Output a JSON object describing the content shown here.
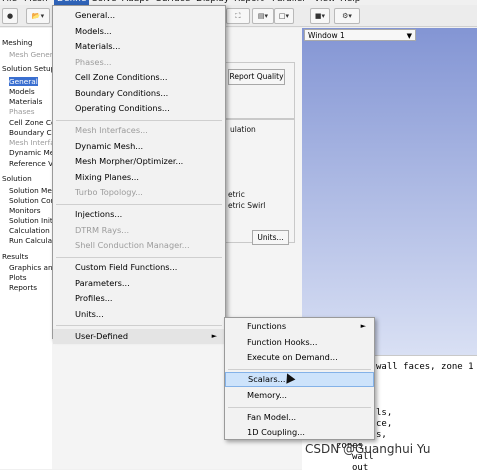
{
  "menubar": {
    "items": [
      {
        "label": "File",
        "active": false
      },
      {
        "label": "Mesh",
        "active": false
      },
      {
        "label": "Define",
        "active": true
      },
      {
        "label": "Solve",
        "active": false
      },
      {
        "label": "Adapt",
        "active": false
      },
      {
        "label": "Surface",
        "active": false
      },
      {
        "label": "Display",
        "active": false
      },
      {
        "label": "Report",
        "active": false
      },
      {
        "label": "Parallel",
        "active": false
      },
      {
        "label": "View",
        "active": false
      },
      {
        "label": "Help",
        "active": false
      }
    ]
  },
  "tree": {
    "items": [
      {
        "label": "Meshing",
        "kind": "h"
      },
      {
        "label": "Mesh Generation",
        "kind": "i g"
      },
      {
        "label": "Solution Setup",
        "kind": "h"
      },
      {
        "label": "General",
        "kind": "i sel"
      },
      {
        "label": "Models",
        "kind": "i"
      },
      {
        "label": "Materials",
        "kind": "i"
      },
      {
        "label": "Phases",
        "kind": "i g"
      },
      {
        "label": "Cell Zone Conditions",
        "kind": "i"
      },
      {
        "label": "Boundary Conditions",
        "kind": "i"
      },
      {
        "label": "Mesh Interfaces",
        "kind": "i g"
      },
      {
        "label": "Dynamic Mesh",
        "kind": "i"
      },
      {
        "label": "Reference Values",
        "kind": "i"
      },
      {
        "label": "Solution",
        "kind": "h"
      },
      {
        "label": "Solution Methods",
        "kind": "i"
      },
      {
        "label": "Solution Controls",
        "kind": "i"
      },
      {
        "label": "Monitors",
        "kind": "i"
      },
      {
        "label": "Solution Initialization",
        "kind": "i"
      },
      {
        "label": "Calculation Activities",
        "kind": "i"
      },
      {
        "label": "Run Calculation",
        "kind": "i"
      },
      {
        "label": "Results",
        "kind": "h"
      },
      {
        "label": "Graphics and Animations",
        "kind": "i"
      },
      {
        "label": "Plots",
        "kind": "i"
      },
      {
        "label": "Reports",
        "kind": "i"
      }
    ]
  },
  "panel": {
    "report_quality": "Report Quality",
    "ulation": "ulation",
    "etric": "etric",
    "etric_swirl": "etric Swirl",
    "units": "Units..."
  },
  "graphics": {
    "window_select": "Window 1"
  },
  "console": {
    "lines": [
      "wall faces, zone 1",
      "ls,",
      "ce,",
      "s,",
      "zones,",
      "wall",
      "out"
    ]
  },
  "define_menu": {
    "items": [
      {
        "label": "General...",
        "disabled": false,
        "submenu": false
      },
      {
        "label": "Models...",
        "disabled": false,
        "submenu": false
      },
      {
        "label": "Materials...",
        "disabled": false,
        "submenu": false
      },
      {
        "label": "Phases...",
        "disabled": true,
        "submenu": false
      },
      {
        "label": "Cell Zone Conditions...",
        "disabled": false,
        "submenu": false
      },
      {
        "label": "Boundary Conditions...",
        "disabled": false,
        "submenu": false
      },
      {
        "label": "Operating Conditions...",
        "disabled": false,
        "submenu": false
      },
      {
        "sep": true
      },
      {
        "label": "Mesh Interfaces...",
        "disabled": true,
        "submenu": false
      },
      {
        "label": "Dynamic Mesh...",
        "disabled": false,
        "submenu": false
      },
      {
        "label": "Mesh Morpher/Optimizer...",
        "disabled": false,
        "submenu": false
      },
      {
        "label": "Mixing Planes...",
        "disabled": false,
        "submenu": false
      },
      {
        "label": "Turbo Topology...",
        "disabled": true,
        "submenu": false
      },
      {
        "sep": true
      },
      {
        "label": "Injections...",
        "disabled": false,
        "submenu": false
      },
      {
        "label": "DTRM Rays...",
        "disabled": true,
        "submenu": false
      },
      {
        "label": "Shell Conduction Manager...",
        "disabled": true,
        "submenu": false
      },
      {
        "sep": true
      },
      {
        "label": "Custom Field Functions...",
        "disabled": false,
        "submenu": false
      },
      {
        "label": "Parameters...",
        "disabled": false,
        "submenu": false
      },
      {
        "label": "Profiles...",
        "disabled": false,
        "submenu": false
      },
      {
        "label": "Units...",
        "disabled": false,
        "submenu": false
      },
      {
        "sep": true
      },
      {
        "label": "User-Defined",
        "disabled": false,
        "submenu": true,
        "highlight": true
      }
    ]
  },
  "udf_menu": {
    "items": [
      {
        "label": "Functions",
        "submenu": true
      },
      {
        "label": "Function Hooks...",
        "submenu": false
      },
      {
        "label": "Execute on Demand...",
        "submenu": false
      },
      {
        "sep": true
      },
      {
        "label": "Scalars...",
        "submenu": false,
        "hover": true
      },
      {
        "label": "Memory...",
        "submenu": false
      },
      {
        "sep": true
      },
      {
        "label": "Fan Model...",
        "submenu": false
      },
      {
        "label": "1D Coupling...",
        "submenu": false
      }
    ]
  },
  "watermark": "CSDN @Guanghui Yu"
}
